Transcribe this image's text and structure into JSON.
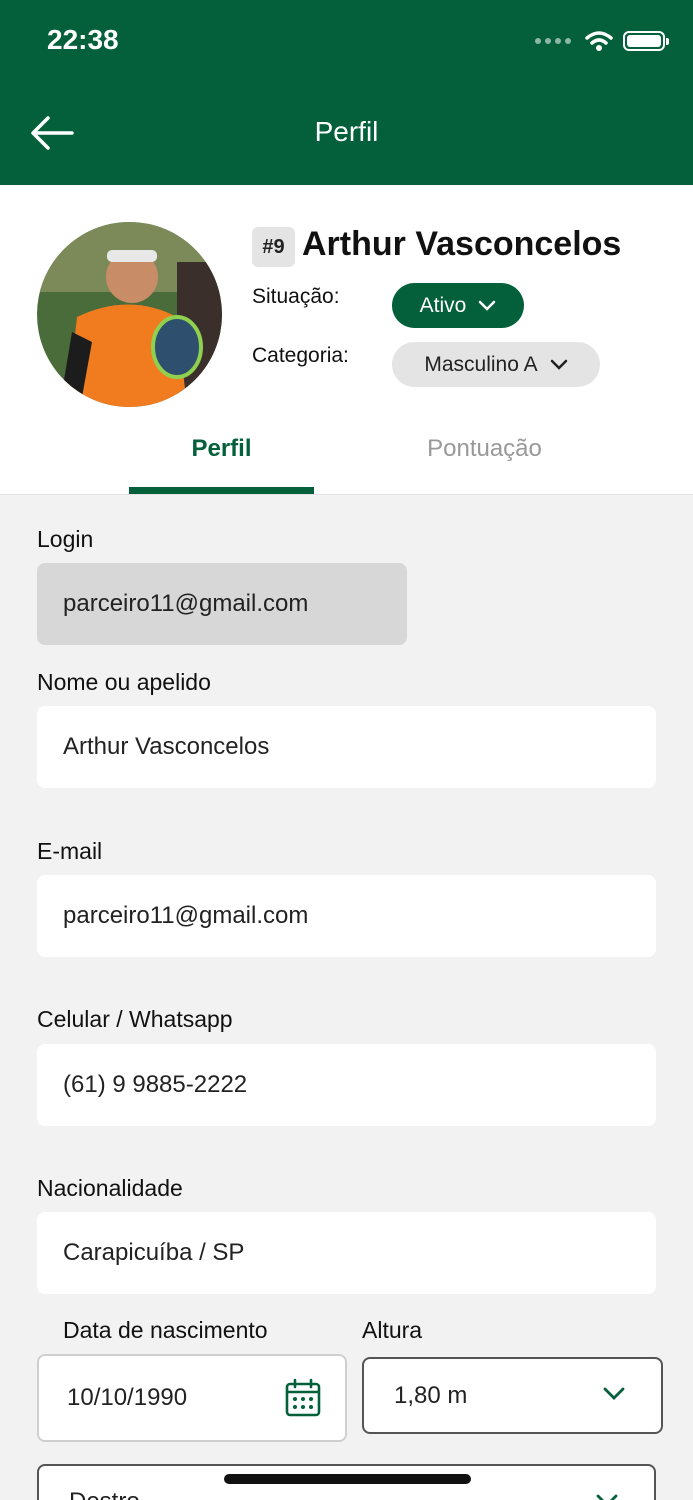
{
  "status_bar": {
    "time": "22:38"
  },
  "header": {
    "title": "Perfil"
  },
  "profile": {
    "rank": "#9",
    "name": "Arthur Vasconcelos",
    "situacao_label": "Situação:",
    "situacao_value": "Ativo",
    "categoria_label": "Categoria:",
    "categoria_value": "Masculino A"
  },
  "tabs": [
    {
      "label": "Perfil",
      "active": true
    },
    {
      "label": "Pontuação",
      "active": false
    }
  ],
  "form": {
    "login": {
      "label": "Login",
      "value": "parceiro11@gmail.com"
    },
    "nome": {
      "label": "Nome ou apelido",
      "value": "Arthur Vasconcelos"
    },
    "email": {
      "label": "E-mail",
      "value": "parceiro11@gmail.com"
    },
    "celular": {
      "label": "Celular / Whatsapp",
      "value": "(61) 9 9885-2222"
    },
    "nacionalidade": {
      "label": "Nacionalidade",
      "value": "Carapicuíba / SP"
    },
    "nascimento": {
      "label": "Data de nascimento",
      "value": "10/10/1990"
    },
    "altura": {
      "label": "Altura",
      "value": "1,80 m"
    },
    "lado": {
      "value": "Destro"
    }
  },
  "colors": {
    "brand": "#03603a",
    "background": "#f2f2f2"
  },
  "icons": [
    "back-arrow-icon",
    "wifi-icon",
    "battery-icon",
    "chevron-down-icon",
    "calendar-icon"
  ]
}
